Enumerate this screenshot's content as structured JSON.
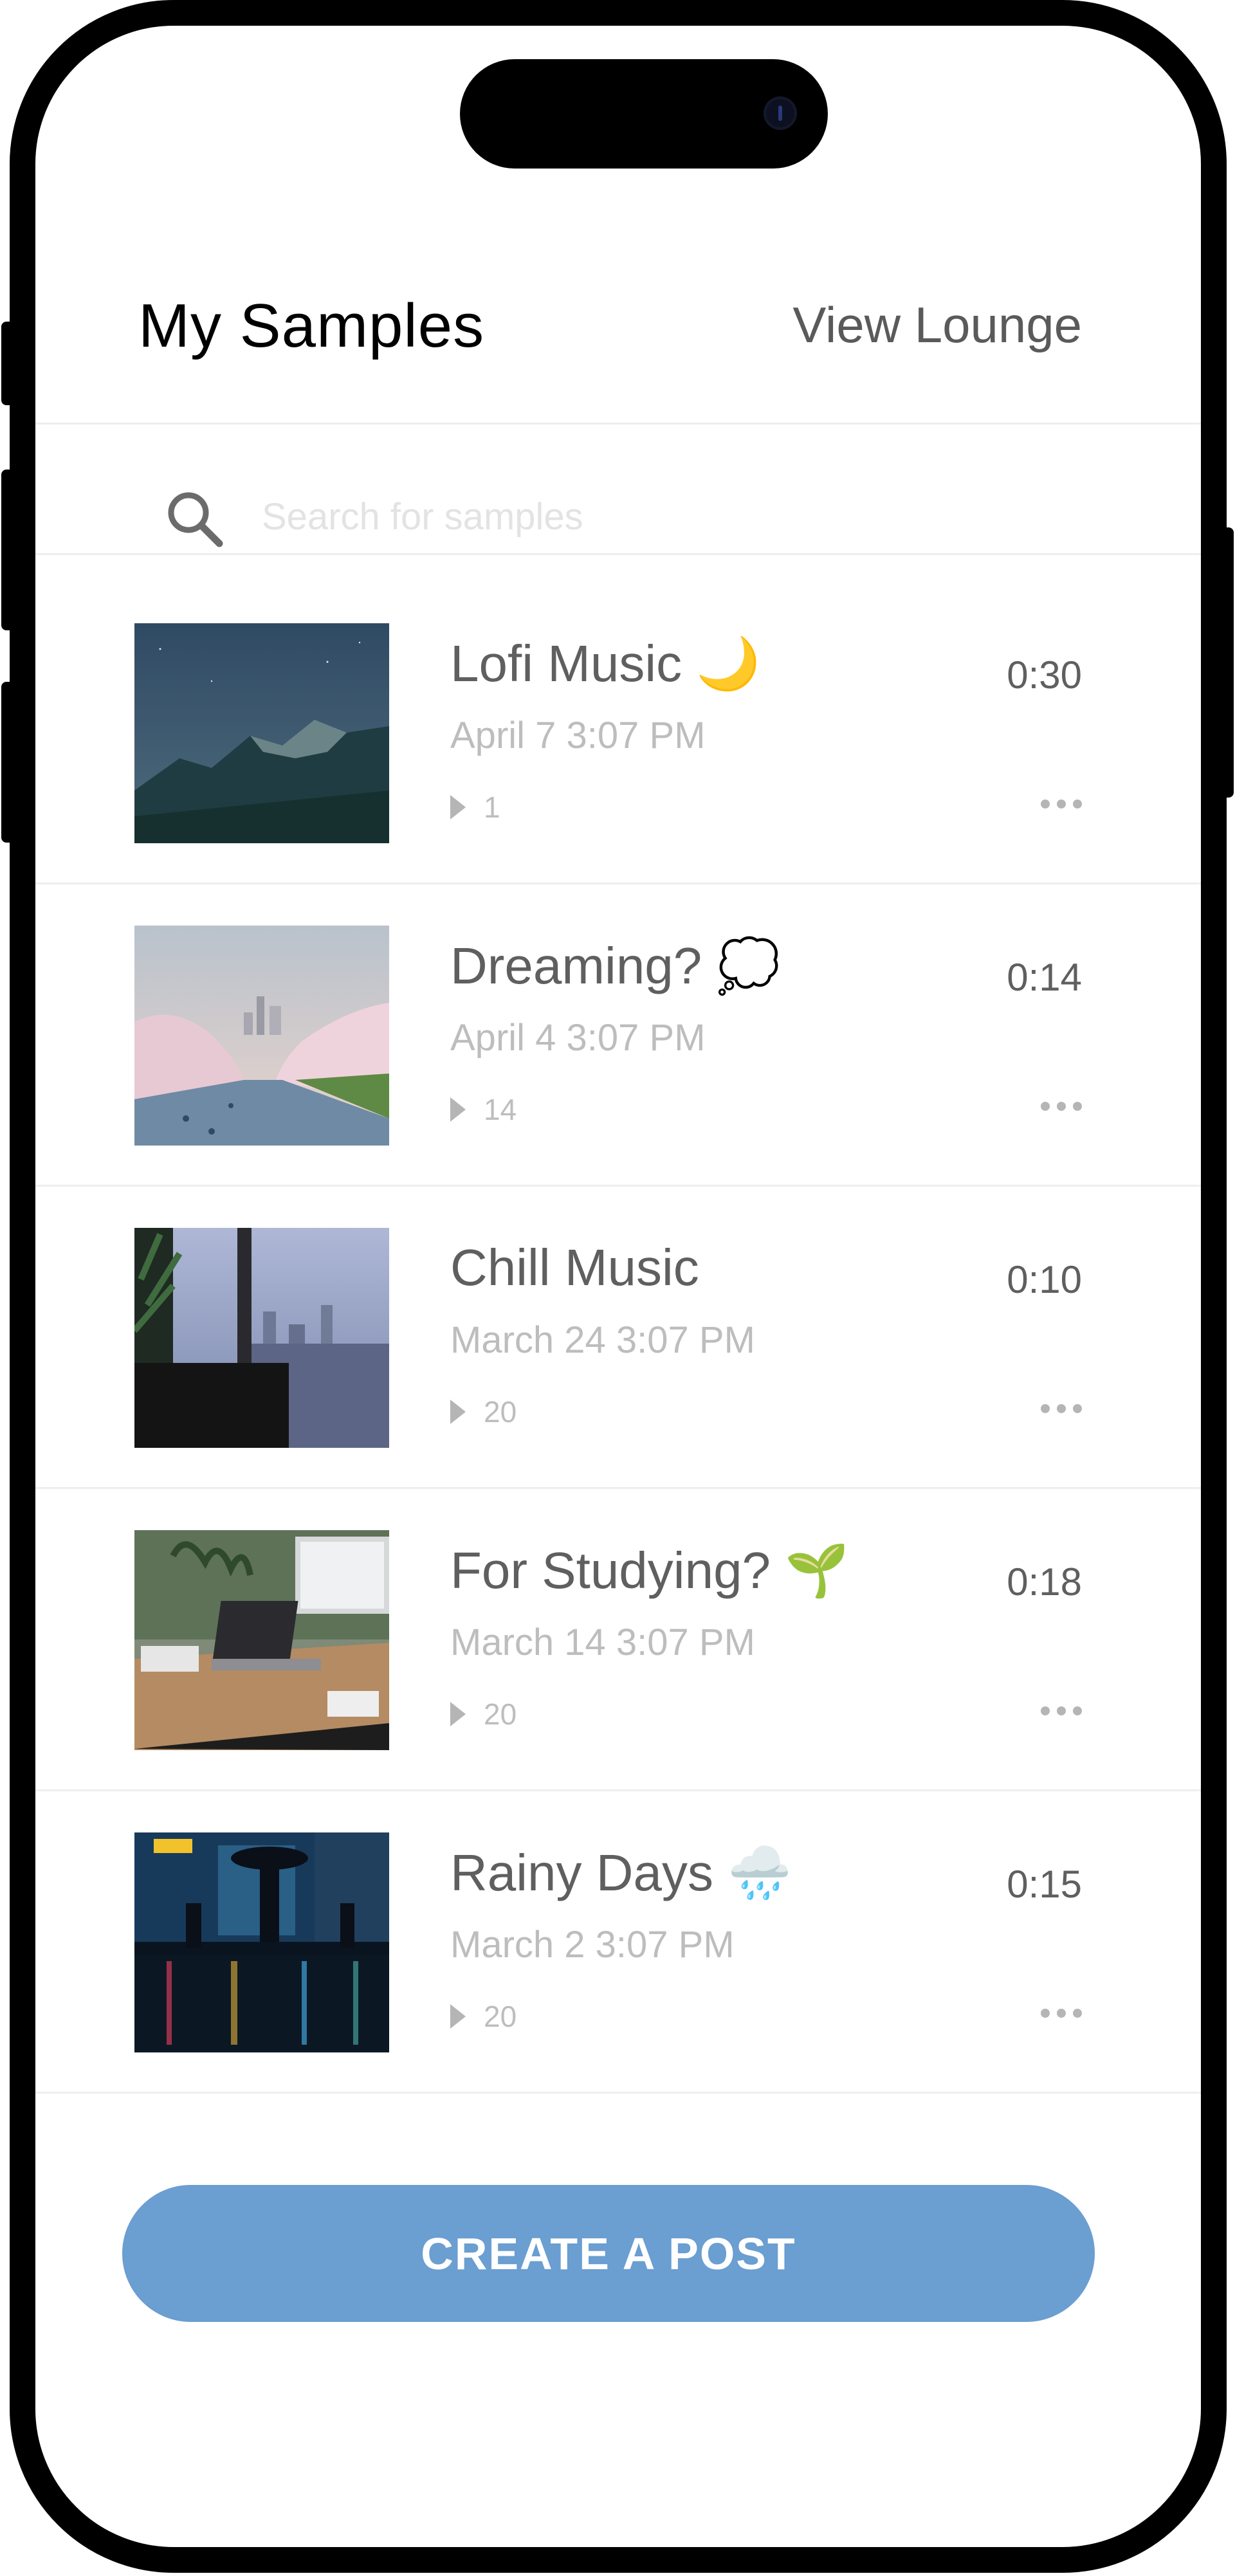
{
  "header": {
    "title": "My Samples",
    "lounge_link": "View Lounge"
  },
  "search": {
    "placeholder": "Search for samples",
    "value": ""
  },
  "samples": [
    {
      "title": "Lofi Music 🌙",
      "date": "April 7 3:07 PM",
      "plays": "1",
      "duration": "0:30",
      "thumbnail": "moonlit-mountain"
    },
    {
      "title": "Dreaming? 💭",
      "date": "April 4 3:07 PM",
      "plays": "14",
      "duration": "0:14",
      "thumbnail": "cherry-blossom-river"
    },
    {
      "title": "Chill Music",
      "date": "March 24 3:07 PM",
      "plays": "20",
      "duration": "0:10",
      "thumbnail": "city-window-view"
    },
    {
      "title": "For Studying? 🌱",
      "date": "March 14 3:07 PM",
      "plays": "20",
      "duration": "0:18",
      "thumbnail": "desk-workspace"
    },
    {
      "title": "Rainy Days 🌧️",
      "date": "March 2 3:07 PM",
      "plays": "20",
      "duration": "0:15",
      "thumbnail": "rainy-night-street"
    }
  ],
  "actions": {
    "create_post": "CREATE A POST"
  },
  "colors": {
    "accent": "#6b9ed1",
    "title_text": "#000000",
    "secondary_text": "#5f5f5f",
    "muted_text": "#bdbdbd"
  }
}
